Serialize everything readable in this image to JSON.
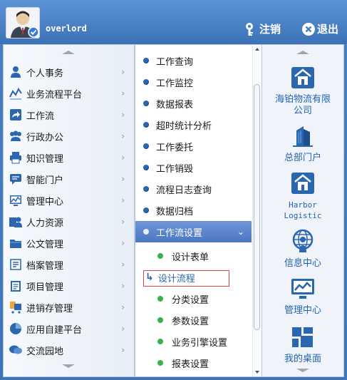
{
  "user": {
    "name": "overlord"
  },
  "header": {
    "logout_label": "注销",
    "exit_label": "退出"
  },
  "menu_level1": [
    {
      "label": "个人事务",
      "icon": "person-icon"
    },
    {
      "label": "业务流程平台",
      "icon": "flow-chart-icon"
    },
    {
      "label": "工作流",
      "icon": "share-arrow-icon"
    },
    {
      "label": "行政办公",
      "icon": "group-icon"
    },
    {
      "label": "知识管理",
      "icon": "printer-icon"
    },
    {
      "label": "智能门户",
      "icon": "chat-icon"
    },
    {
      "label": "管理中心",
      "icon": "monitor-chart-icon"
    },
    {
      "label": "人力资源",
      "icon": "people-icon"
    },
    {
      "label": "公文管理",
      "icon": "folder-icon"
    },
    {
      "label": "档案管理",
      "icon": "archive-icon"
    },
    {
      "label": "项目管理",
      "icon": "clipboard-icon"
    },
    {
      "label": "进销存管理",
      "icon": "cart-icon"
    },
    {
      "label": "应用自建平台",
      "icon": "pie-chart-icon"
    },
    {
      "label": "交流园地",
      "icon": "speech-bubble-icon"
    }
  ],
  "menu_level2": [
    {
      "label": "工作查询"
    },
    {
      "label": "工作监控"
    },
    {
      "label": "数据报表"
    },
    {
      "label": "超时统计分析"
    },
    {
      "label": "工作委托"
    },
    {
      "label": "工作销毁"
    },
    {
      "label": "流程日志查询"
    },
    {
      "label": "数据归档"
    },
    {
      "label": "工作流设置",
      "active": true
    }
  ],
  "submenu": [
    {
      "label": "设计表单"
    },
    {
      "label": "设计流程",
      "selected": true
    },
    {
      "label": "分类设置"
    },
    {
      "label": "参数设置"
    },
    {
      "label": "业务引擎设置"
    },
    {
      "label": "报表设置"
    }
  ],
  "shortcuts": [
    {
      "label": "海铂物流有限公司",
      "icon": "house-icon"
    },
    {
      "label": "总部门户",
      "icon": "buildings-icon"
    },
    {
      "label": "Harbor Logistic",
      "icon": "house-icon"
    },
    {
      "label": "信息中心",
      "icon": "globe-person-icon"
    },
    {
      "label": "管理中心",
      "icon": "monitor-chart-icon"
    },
    {
      "label": "我的桌面",
      "icon": "grid-desktop-icon"
    }
  ],
  "colors": {
    "accent": "#1f63b3",
    "header": "#4a7fc1",
    "active": "#5b85cc",
    "selected_border": "#d84a4a"
  }
}
